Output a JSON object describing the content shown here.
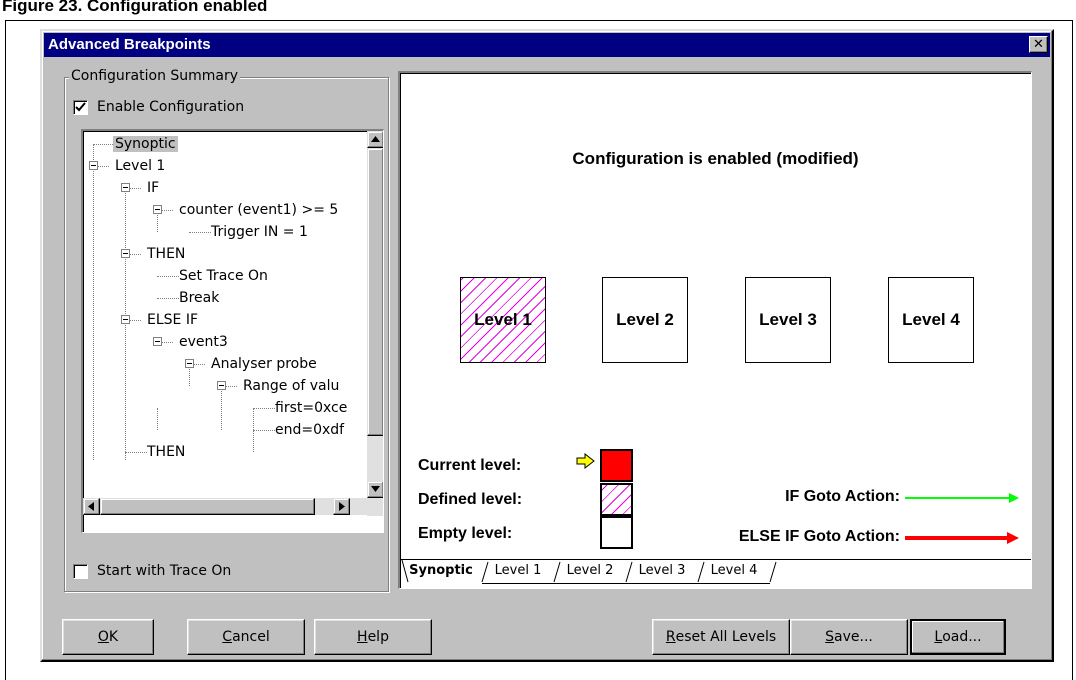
{
  "figure_caption": "Figure 23. Configuration enabled",
  "dialog": {
    "title": "Advanced Breakpoints",
    "close_label": "✕"
  },
  "summary": {
    "group_label": "Configuration Summary",
    "enable_label": "Enable Configuration",
    "enable_checked": true,
    "start_trace_label": "Start with Trace On",
    "start_trace_checked": false,
    "tree": [
      {
        "label": "Synoptic",
        "depth": 0,
        "expander": false,
        "selected": true
      },
      {
        "label": "Level 1",
        "depth": 0,
        "expander": true
      },
      {
        "label": "IF",
        "depth": 1,
        "expander": true
      },
      {
        "label": "counter (event1) >= 5",
        "depth": 2,
        "expander": true
      },
      {
        "label": "Trigger IN = 1",
        "depth": 3,
        "expander": false
      },
      {
        "label": "THEN",
        "depth": 1,
        "expander": true
      },
      {
        "label": "Set Trace On",
        "depth": 2,
        "expander": false
      },
      {
        "label": "Break",
        "depth": 2,
        "expander": false
      },
      {
        "label": "ELSE IF",
        "depth": 1,
        "expander": true
      },
      {
        "label": "event3",
        "depth": 2,
        "expander": true
      },
      {
        "label": "Analyser probe",
        "depth": 3,
        "expander": true
      },
      {
        "label": "Range of valu",
        "depth": 4,
        "expander": true
      },
      {
        "label": "first=0xce",
        "depth": 5,
        "expander": false
      },
      {
        "label": "end=0xdf",
        "depth": 5,
        "expander": false
      },
      {
        "label": "THEN",
        "depth": 1,
        "expander": false
      }
    ]
  },
  "synoptic": {
    "status_text": "Configuration is enabled (modified)",
    "levels": [
      {
        "label": "Level 1",
        "state": "defined"
      },
      {
        "label": "Level 2",
        "state": "empty"
      },
      {
        "label": "Level 3",
        "state": "empty"
      },
      {
        "label": "Level 4",
        "state": "empty"
      }
    ],
    "legend": {
      "current": "Current level:",
      "defined": "Defined level:",
      "empty": "Empty level:"
    },
    "actions": {
      "if_goto": "IF Goto Action:",
      "else_if_goto": "ELSE IF Goto Action:",
      "if_color": "#00ff00",
      "else_if_color": "#ff0000"
    }
  },
  "tabs": [
    "Synoptic",
    "Level 1",
    "Level 2",
    "Level 3",
    "Level 4"
  ],
  "buttons": {
    "ok": {
      "u": "O",
      "rest": "K"
    },
    "cancel": {
      "u": "C",
      "rest": "ancel"
    },
    "help": {
      "u": "H",
      "rest": "elp"
    },
    "reset": {
      "u": "R",
      "rest": "eset All Levels"
    },
    "save": {
      "u": "S",
      "rest": "ave..."
    },
    "load": {
      "u": "L",
      "rest": "oad..."
    }
  },
  "colors": {
    "titlebar": "#000080",
    "current_level": "#ff0000",
    "defined_hatch": "#e600e6",
    "dialog_face": "#c0c0c0"
  }
}
